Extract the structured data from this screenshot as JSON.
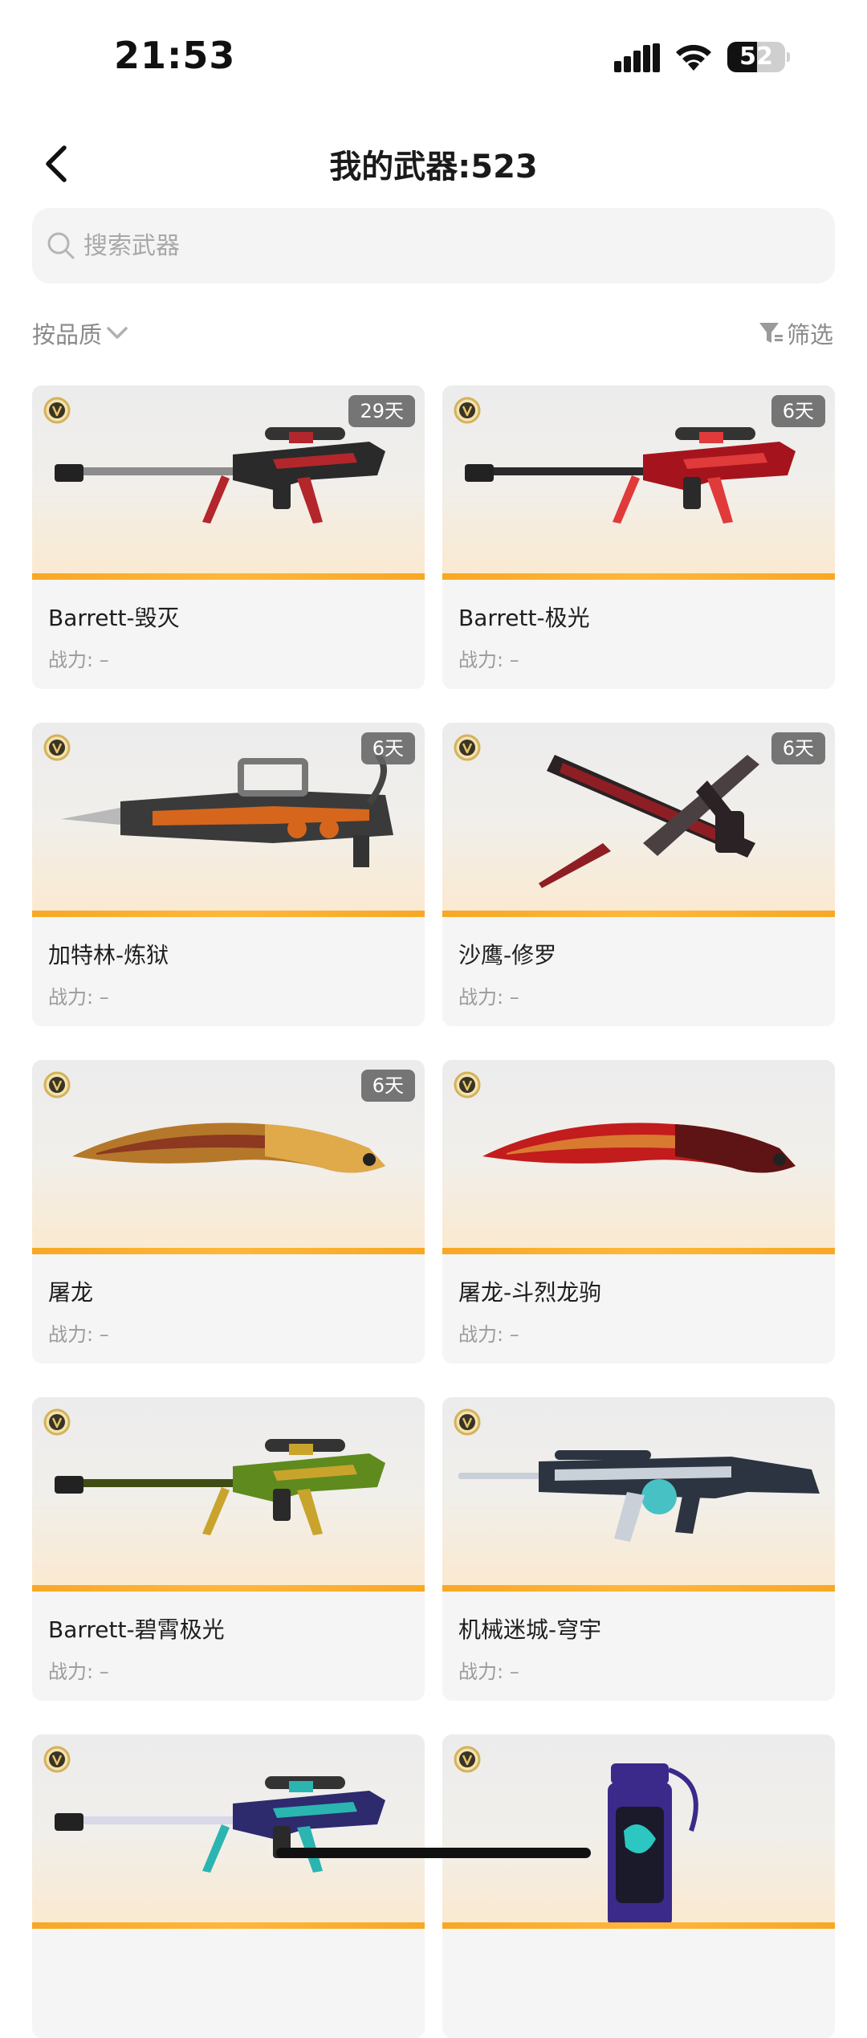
{
  "status_bar": {
    "time": "21:53",
    "battery": "52",
    "battery_level": 0.52
  },
  "nav": {
    "title": "我的武器:523"
  },
  "search": {
    "placeholder": "搜索武器",
    "value": ""
  },
  "toolbar": {
    "sort_label": "按品质",
    "filter_label": "筛选"
  },
  "weapons": [
    {
      "name": "Barrett-毁灭",
      "power": "战力: –",
      "days": "29天",
      "art": "sniper",
      "palette": [
        "#2a2a2a",
        "#b3262b",
        "#8c8c8c"
      ]
    },
    {
      "name": "Barrett-极光",
      "power": "战力: –",
      "days": "6天",
      "art": "sniper",
      "palette": [
        "#a5141c",
        "#e03a3a",
        "#2a2a2a"
      ]
    },
    {
      "name": "加特林-炼狱",
      "power": "战力: –",
      "days": "6天",
      "art": "gatling",
      "palette": [
        "#3a3a3a",
        "#d7661d",
        "#b9b9b9"
      ]
    },
    {
      "name": "沙鹰-修罗",
      "power": "战力: –",
      "days": "6天",
      "art": "pistols",
      "palette": [
        "#2a2224",
        "#8f1e24",
        "#4a4042"
      ]
    },
    {
      "name": "屠龙",
      "power": "战力: –",
      "days": "6天",
      "art": "blade",
      "palette": [
        "#b5782a",
        "#7c1d1d",
        "#e0a94a"
      ]
    },
    {
      "name": "屠龙-斗烈龙驹",
      "power": "战力: –",
      "days": "",
      "art": "blade",
      "palette": [
        "#c21c1c",
        "#e2a33b",
        "#5e1414"
      ]
    },
    {
      "name": "Barrett-碧霄极光",
      "power": "战力: –",
      "days": "",
      "art": "sniper",
      "palette": [
        "#5f8a1d",
        "#c9a42c",
        "#3f4d12"
      ]
    },
    {
      "name": "机械迷城-穹宇",
      "power": "战力: –",
      "days": "",
      "art": "rifle",
      "palette": [
        "#2b3440",
        "#47c1c4",
        "#c9d0d8"
      ]
    },
    {
      "name": "",
      "power": "",
      "days": "",
      "art": "sniper",
      "palette": [
        "#2e2a6e",
        "#2bb5b0",
        "#d8d8e8"
      ]
    },
    {
      "name": "",
      "power": "",
      "days": "",
      "art": "grenade",
      "palette": [
        "#3b2a8a",
        "#2cc7c0",
        "#1a1a2a"
      ]
    }
  ]
}
